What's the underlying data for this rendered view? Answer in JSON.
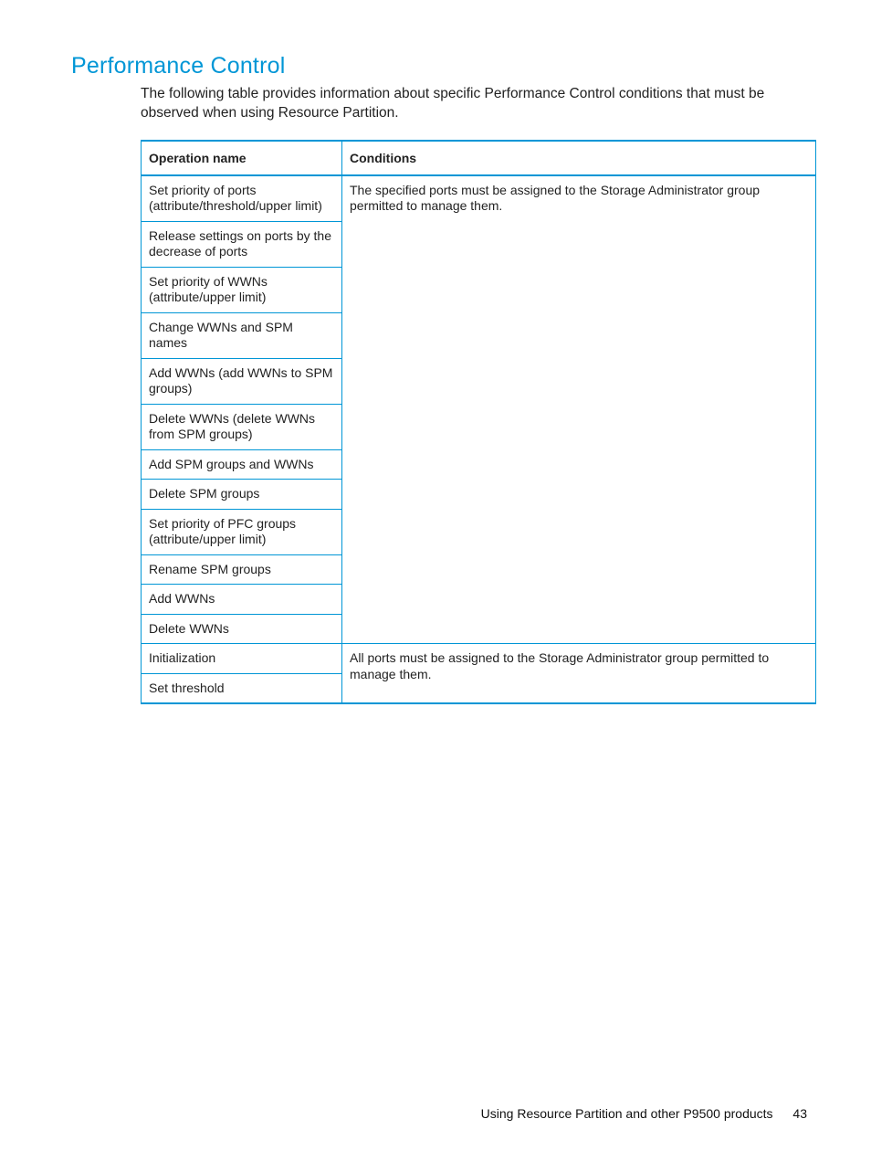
{
  "section_title": "Performance Control",
  "intro": "The following table provides information about specific Performance Control conditions that must be observed when using Resource Partition.",
  "table": {
    "headers": {
      "op": "Operation name",
      "cond": "Conditions"
    },
    "groups": [
      {
        "condition": "The specified ports must be assigned to the Storage Administrator group permitted to manage them.",
        "ops": [
          "Set priority of ports (attribute/threshold/upper limit)",
          "Release settings on ports by the decrease of ports",
          "Set priority of WWNs (attribute/upper limit)",
          "Change WWNs and SPM names",
          "Add WWNs (add WWNs to SPM groups)",
          "Delete WWNs (delete WWNs from SPM groups)",
          "Add SPM groups and WWNs",
          "Delete SPM groups",
          "Set priority of PFC groups (attribute/upper limit)",
          "Rename SPM groups",
          "Add WWNs",
          "Delete WWNs"
        ]
      },
      {
        "condition": "All ports must be assigned to the Storage Administrator group permitted to manage them.",
        "ops": [
          "Initialization",
          "Set threshold"
        ]
      }
    ]
  },
  "footer": {
    "text": "Using Resource Partition and other P9500 products",
    "page": "43"
  }
}
